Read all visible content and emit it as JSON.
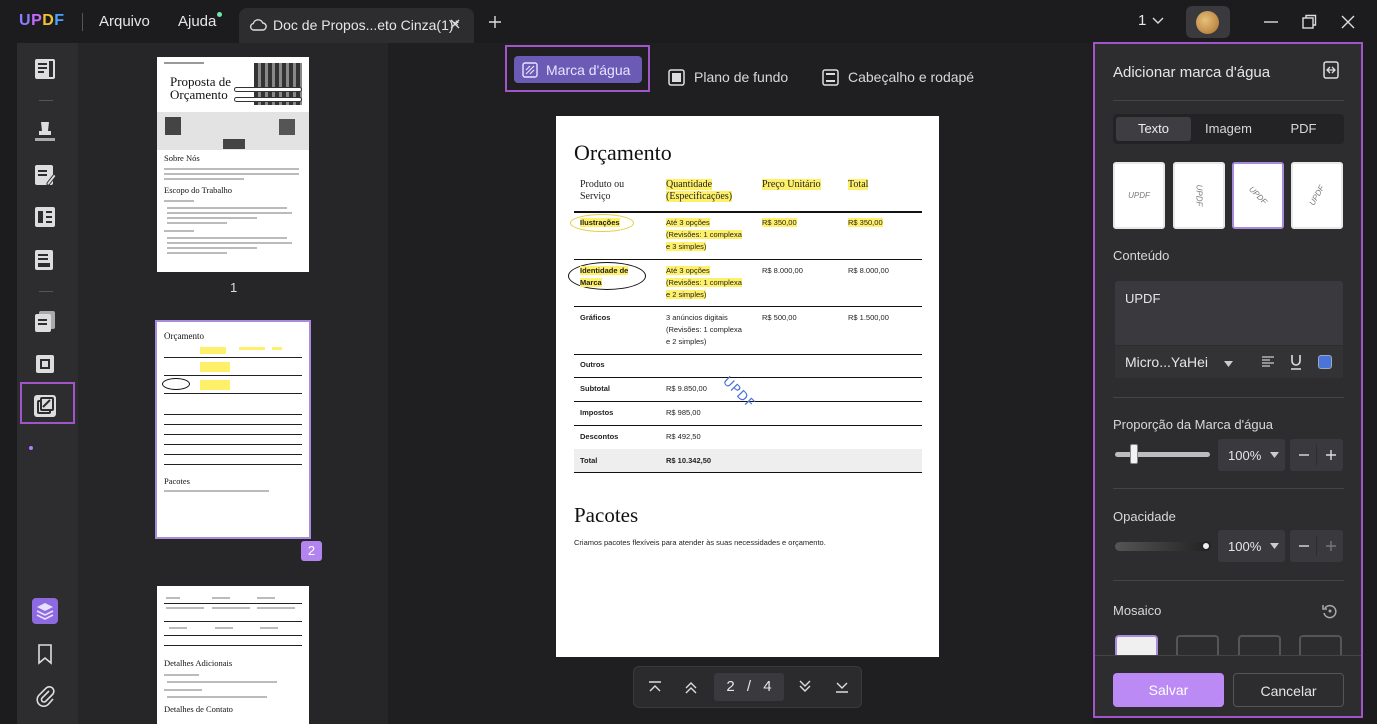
{
  "app": {
    "logo": {
      "u": "U",
      "p": "P",
      "d": "D",
      "f": "F"
    },
    "menu": {
      "file": "Arquivo",
      "help": "Ajuda"
    },
    "tab_title": "Doc de Propos...eto Cinza(1)*",
    "page_selector": "1"
  },
  "toolbar": {
    "watermark": "Marca d'água",
    "background": "Plano de fundo",
    "header_footer": "Cabeçalho e rodapé"
  },
  "thumbnails": {
    "page1_number": "1",
    "page2_number": "2",
    "page1": {
      "title_line1": "Proposta de",
      "title_line2": "Orçamento",
      "section1": "Sobre Nós",
      "section2": "Escopo do Trabalho"
    },
    "page2": {
      "title": "Orçamento",
      "section": "Pacotes"
    },
    "page3": {
      "section1": "Detalhes Adicionais",
      "section2": "Detalhes de Contato"
    }
  },
  "document": {
    "title": "Orçamento",
    "headers": {
      "product": [
        "Produto ou",
        "Serviço"
      ],
      "quantity": [
        "Quantidade",
        "(Especificações)"
      ],
      "unit_price": "Preço Unitário",
      "total": "Total"
    },
    "rows": [
      {
        "name": "Ilustrações",
        "spec": [
          "Até 3 opções",
          "(Revisões: 1 complexa",
          "e 3 simples)"
        ],
        "price": "R$ 350,00",
        "total": "R$ 350,00"
      },
      {
        "name": "Identidade de Marca",
        "spec": [
          "Até 3 opções",
          "(Revisões: 1 complexa",
          "e 2 simples)"
        ],
        "price": "R$ 8.000,00",
        "total": "R$ 8.000,00"
      },
      {
        "name": "Gráficos",
        "spec": [
          "3 anúncios digitais",
          "(Revisões: 1 complexa",
          "e 2 simples)"
        ],
        "price": "R$ 500,00",
        "total": "R$ 1.500,00"
      }
    ],
    "summary": [
      {
        "label": "Outros",
        "value": ""
      },
      {
        "label": "Subtotal",
        "value": "R$ 9.850,00"
      },
      {
        "label": "Impostos",
        "value": "R$ 985,00"
      },
      {
        "label": "Descontos",
        "value": "R$ 492,50"
      },
      {
        "label": "Total",
        "value": "R$ 10.342,50"
      }
    ],
    "watermark_text": "UPDF",
    "section2_title": "Pacotes",
    "section2_text": "Criamos pacotes flexíveis para atender às suas necessidades e orçamento."
  },
  "pager": {
    "current": "2",
    "separator": "/",
    "total": "4"
  },
  "panel": {
    "title": "Adicionar marca d'água",
    "tabs": [
      "Texto",
      "Imagem",
      "PDF"
    ],
    "active_tab": "Texto",
    "template_label": "UPDF",
    "content_label": "Conteúdo",
    "content_value": "UPDF",
    "font_name": "Micro...YaHei",
    "scale_label": "Proporção da Marca d'água",
    "scale_value": "100%",
    "opacity_label": "Opacidade",
    "opacity_value": "100%",
    "mosaic_label": "Mosaico",
    "save_label": "Salvar",
    "cancel_label": "Cancelar"
  },
  "colors": {
    "accent": "#a254c9",
    "accent_light": "#bb8af5",
    "highlight": "#fff06a",
    "watermark": "#4b74d8"
  }
}
